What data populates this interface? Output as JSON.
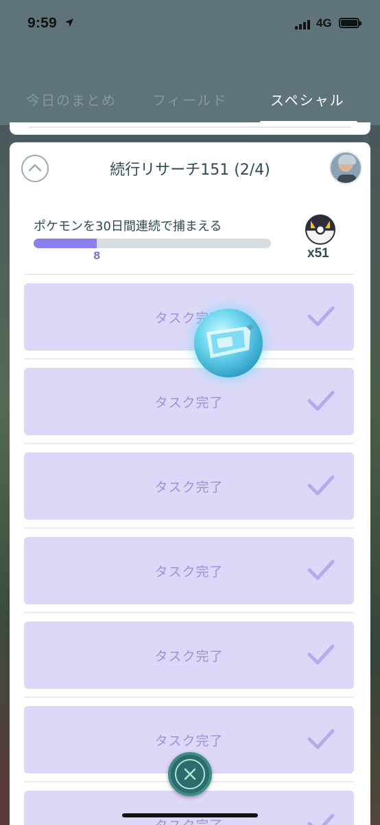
{
  "status_bar": {
    "time": "9:59",
    "network": "4G"
  },
  "tabs": [
    {
      "label": "今日のまとめ",
      "active": false
    },
    {
      "label": "フィールド",
      "active": false
    },
    {
      "label": "スペシャル",
      "active": true
    }
  ],
  "research": {
    "title": "続行リサーチ151 (2/4)",
    "goal": "ポケモンを30日間連続で捕まえる",
    "progress_value": 8,
    "progress_total": 30,
    "progress_label": "8",
    "reward_count": "x51",
    "reward_icon": "ultra-ball-icon"
  },
  "tasks": [
    {
      "label": "タスク完了"
    },
    {
      "label": "タスク完了"
    },
    {
      "label": "タスク完了"
    },
    {
      "label": "タスク完了"
    },
    {
      "label": "タスク完了"
    },
    {
      "label": "タスク完了"
    },
    {
      "label": "タスク完了"
    }
  ],
  "colors": {
    "header": "#5f747a",
    "task_bg": "#ddd8f7",
    "task_text": "#9a92de",
    "progress_fill": "#8b7ff0",
    "title_text": "#2f4952"
  }
}
